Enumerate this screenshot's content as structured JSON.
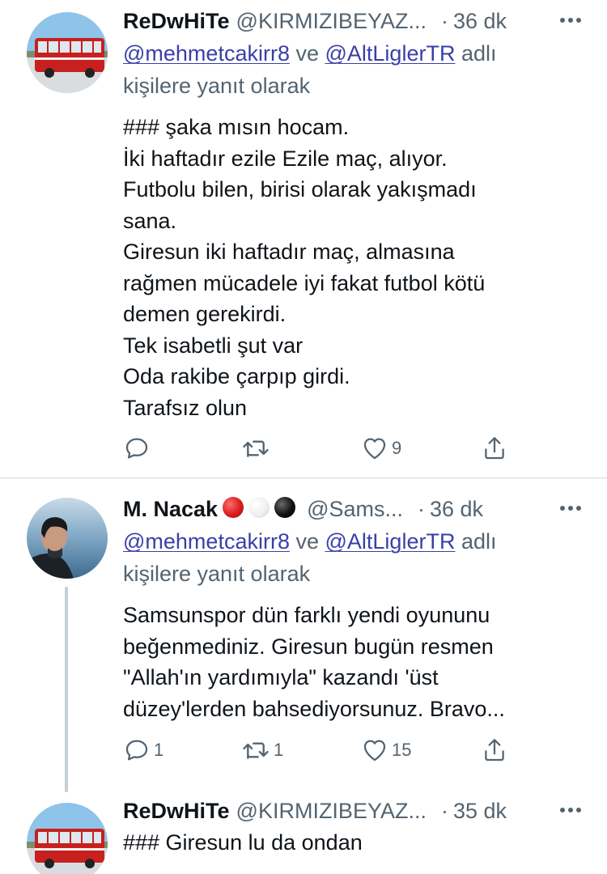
{
  "tweets": [
    {
      "name": "ReDwHiTe",
      "handle": "@KIRMIZIBEYAZ...",
      "dot": "·",
      "time": "36 dk",
      "reply_mention_1": "@mehmetcakirr8",
      "reply_joiner": " ve ",
      "reply_mention_2": "@AltLiglerTR",
      "reply_suffix_1": " adlı",
      "reply_suffix_2": "kişilere yanıt olarak",
      "body": [
        "### şaka mısın hocam.",
        "İki haftadır ezile Ezile maç, alıyor.",
        "Futbolu bilen, birisi olarak yakışmadı",
        "sana.",
        "Giresun iki haftadır maç, almasına",
        "rağmen mücadele iyi fakat futbol kötü",
        "demen gerekirdi.",
        "Tek isabetli şut var",
        "Oda rakibe çarpıp girdi.",
        "Tarafsız olun"
      ],
      "reply_count": "",
      "retweet_count": "",
      "like_count": "9"
    },
    {
      "name": "M. Nacak",
      "emoji_colors": [
        "#d81e1e",
        "#f2f2f2",
        "#111111"
      ],
      "handle": "@Sams...",
      "dot": "·",
      "time": "36 dk",
      "reply_mention_1": "@mehmetcakirr8",
      "reply_joiner": " ve ",
      "reply_mention_2": "@AltLiglerTR",
      "reply_suffix_1": " adlı",
      "reply_suffix_2": "kişilere yanıt olarak",
      "body": [
        "Samsunspor dün farklı yendi oyununu",
        "beğenmediniz. Giresun bugün resmen",
        "\"Allah'ın yardımıyla\" kazandı 'üst",
        "düzey'lerden bahsediyorsunuz. Bravo..."
      ],
      "reply_count": "1",
      "retweet_count": "1",
      "like_count": "15"
    },
    {
      "name": "ReDwHiTe",
      "handle": "@KIRMIZIBEYAZ...",
      "dot": "·",
      "time": "35 dk",
      "body": [
        "### Giresun lu da ondan"
      ]
    }
  ],
  "colors": {
    "secondary_text": "#536471",
    "mention": "#3a3fa8",
    "divider": "#cfd9de",
    "thread_line": "#c4cfd6",
    "bus_red": "#c8201e"
  },
  "icons": [
    "reply-icon",
    "retweet-icon",
    "like-icon",
    "share-icon",
    "more-icon"
  ]
}
